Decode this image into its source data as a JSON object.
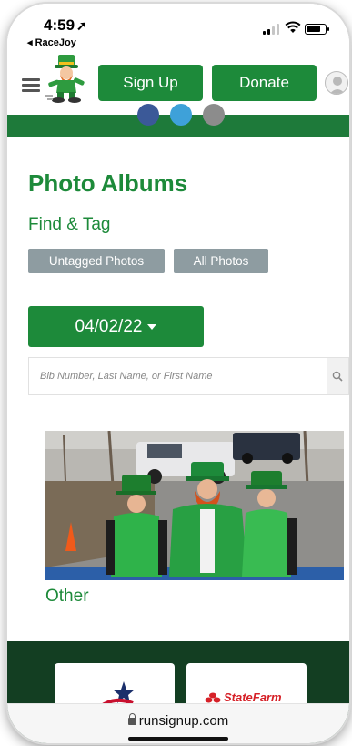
{
  "status_bar": {
    "time": "4:59",
    "back_app": "◂ RaceJoy",
    "signal_bars": 2,
    "battery_fraction": 0.7
  },
  "header": {
    "signup_label": "Sign Up",
    "donate_label": "Donate",
    "menu_icon": "hamburger-icon",
    "avatar_icon": "user-avatar-icon"
  },
  "social_icons": [
    "facebook-icon",
    "twitter-icon",
    "email-icon"
  ],
  "page": {
    "title": "Photo Albums",
    "subtitle": "Find & Tag",
    "filters": [
      "Untagged Photos",
      "All Photos"
    ],
    "date": "04/02/22",
    "search_placeholder": "Bib Number, Last Name, or First Name"
  },
  "album": {
    "label": "Other"
  },
  "sponsors": [
    {
      "name": "us-flag-star-logo"
    },
    {
      "name": "StateFarm"
    }
  ],
  "browser": {
    "url": "runsignup.com"
  },
  "colors": {
    "brand_green": "#1d8a3a",
    "footer_green": "#133e22",
    "chip_gray": "#8e9ca1"
  }
}
